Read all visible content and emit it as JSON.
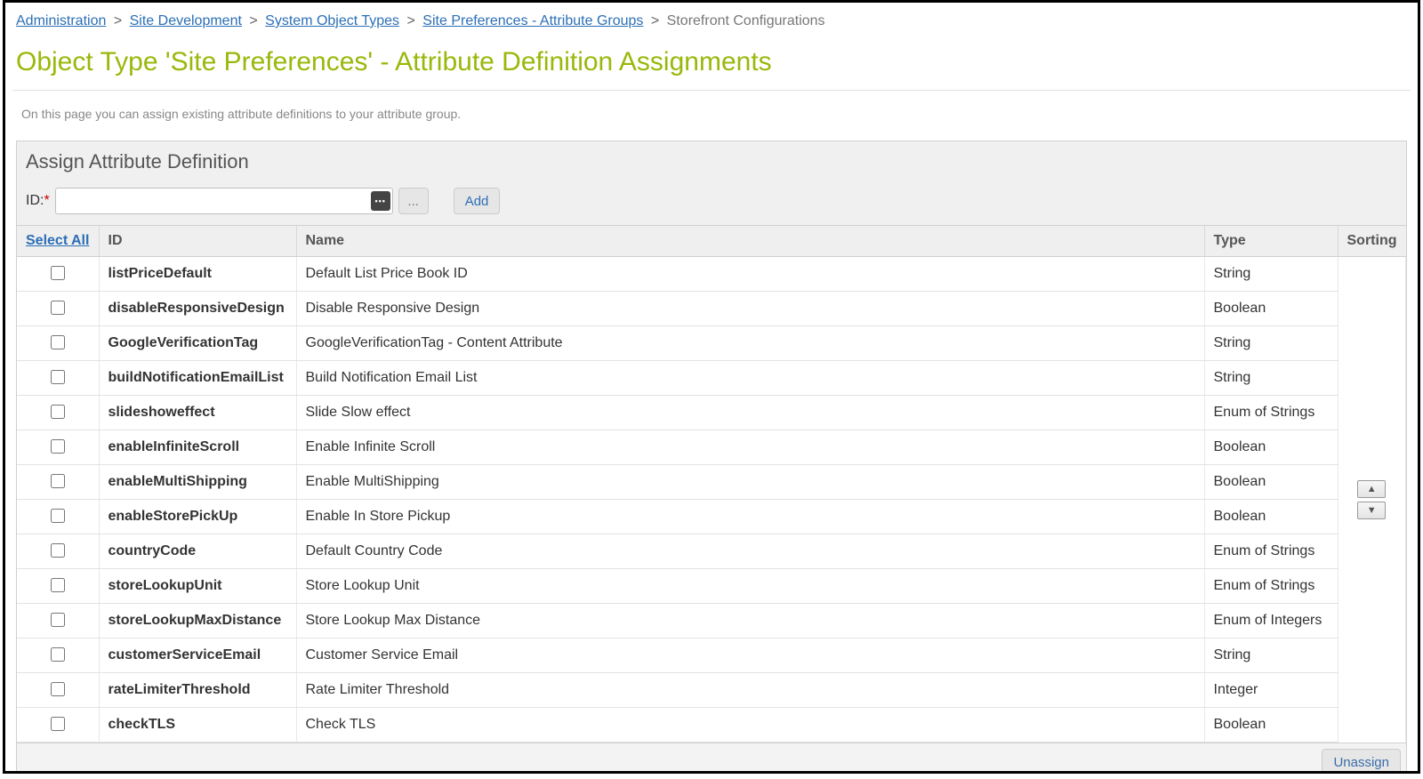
{
  "breadcrumbs": [
    {
      "label": "Administration",
      "link": true
    },
    {
      "label": "Site Development",
      "link": true
    },
    {
      "label": "System Object Types",
      "link": true
    },
    {
      "label": "Site Preferences - Attribute Groups",
      "link": true
    },
    {
      "label": "Storefront Configurations",
      "link": false
    }
  ],
  "page_title": "Object Type 'Site Preferences' - Attribute Definition Assignments",
  "page_desc": "On this page you can assign existing attribute definitions to your attribute group.",
  "panel": {
    "title": "Assign Attribute Definition",
    "id_label": "ID:",
    "id_value": "",
    "ellipsis_label": "...",
    "add_label": "Add"
  },
  "table": {
    "headers": {
      "select_all": "Select All",
      "id": "ID",
      "name": "Name",
      "type": "Type",
      "sorting": "Sorting"
    },
    "rows": [
      {
        "id": "listPriceDefault",
        "name": "Default List Price Book ID",
        "type": "String"
      },
      {
        "id": "disableResponsiveDesign",
        "name": "Disable Responsive Design",
        "type": "Boolean"
      },
      {
        "id": "GoogleVerificationTag",
        "name": "GoogleVerificationTag - Content Attribute",
        "type": "String"
      },
      {
        "id": "buildNotificationEmailList",
        "name": "Build Notification Email List",
        "type": "String"
      },
      {
        "id": "slideshoweffect",
        "name": "Slide Slow effect",
        "type": "Enum of Strings"
      },
      {
        "id": "enableInfiniteScroll",
        "name": "Enable Infinite Scroll",
        "type": "Boolean"
      },
      {
        "id": "enableMultiShipping",
        "name": "Enable MultiShipping",
        "type": "Boolean"
      },
      {
        "id": "enableStorePickUp",
        "name": "Enable In Store Pickup",
        "type": "Boolean"
      },
      {
        "id": "countryCode",
        "name": "Default Country Code",
        "type": "Enum of Strings"
      },
      {
        "id": "storeLookupUnit",
        "name": "Store Lookup Unit",
        "type": "Enum of Strings"
      },
      {
        "id": "storeLookupMaxDistance",
        "name": "Store Lookup Max Distance",
        "type": "Enum of Integers"
      },
      {
        "id": "customerServiceEmail",
        "name": "Customer Service Email",
        "type": "String"
      },
      {
        "id": "rateLimiterThreshold",
        "name": "Rate Limiter Threshold",
        "type": "Integer"
      },
      {
        "id": "checkTLS",
        "name": "Check TLS",
        "type": "Boolean"
      }
    ]
  },
  "footer": {
    "unassign_label": "Unassign"
  }
}
